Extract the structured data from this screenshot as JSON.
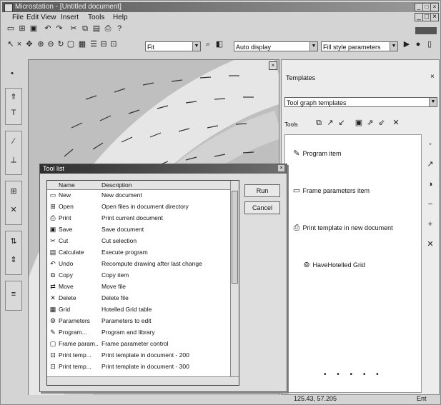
{
  "window": {
    "title": "Microstation - [Untitled document]"
  },
  "menu": [
    {
      "label": "File"
    },
    {
      "label": "Edit"
    },
    {
      "label": "View"
    },
    {
      "label": "Insert"
    },
    {
      "label": "Tools"
    },
    {
      "label": "Help"
    }
  ],
  "toolbar2": {
    "zoom_value": "Fit",
    "layer_value": "Auto display",
    "params_value": "Fill style parameters"
  },
  "right_panel": {
    "header": "Templates",
    "dropdown_value": "Tool graph templates",
    "toolbar_label": "Tools",
    "items": [
      {
        "label": "Program item"
      },
      {
        "label": "Frame parameters item"
      },
      {
        "label": "Print template in new document"
      },
      {
        "label": "HaveHotelled Grid"
      }
    ]
  },
  "dialog": {
    "title": "Tool list",
    "col_name": "Name",
    "col_desc": "Description",
    "ok_label": "Run",
    "cancel_label": "Cancel",
    "rows": [
      {
        "icon": "new-icon",
        "name": "New",
        "desc": "New document"
      },
      {
        "icon": "open-icon",
        "name": "Open",
        "desc": "Open files in document directory"
      },
      {
        "icon": "print-icon",
        "name": "Print",
        "desc": "Print current document"
      },
      {
        "icon": "save-icon",
        "name": "Save",
        "desc": "Save document"
      },
      {
        "icon": "cut-icon",
        "name": "Cut",
        "desc": "Cut selection"
      },
      {
        "icon": "calculate-icon",
        "name": "Calculate",
        "desc": "Execute program"
      },
      {
        "icon": "undo-icon",
        "name": "Undo",
        "desc": "Recompute drawing after last change"
      },
      {
        "icon": "copy-icon",
        "name": "Copy",
        "desc": "Copy item"
      },
      {
        "icon": "move-icon",
        "name": "Move",
        "desc": "Move file"
      },
      {
        "icon": "delete-icon",
        "name": "Delete",
        "desc": "Delete file"
      },
      {
        "icon": "grid-icon",
        "name": "Grid",
        "desc": "Hotelled Grid table"
      },
      {
        "icon": "param-icon",
        "name": "Parameters",
        "desc": "Parameters to edit"
      },
      {
        "icon": "program-icon",
        "name": "Program...",
        "desc": "Program and library"
      },
      {
        "icon": "frame-icon",
        "name": "Frame param...",
        "desc": "Frame parameter control"
      },
      {
        "icon": "template-icon",
        "name": "Print temp...",
        "desc": "Print template in document - 200"
      },
      {
        "icon": "template-icon",
        "name": "Print temp...",
        "desc": "Print template in document - 300"
      }
    ]
  },
  "status": {
    "coords": "125.43, 57.205",
    "mode": "Ent"
  }
}
